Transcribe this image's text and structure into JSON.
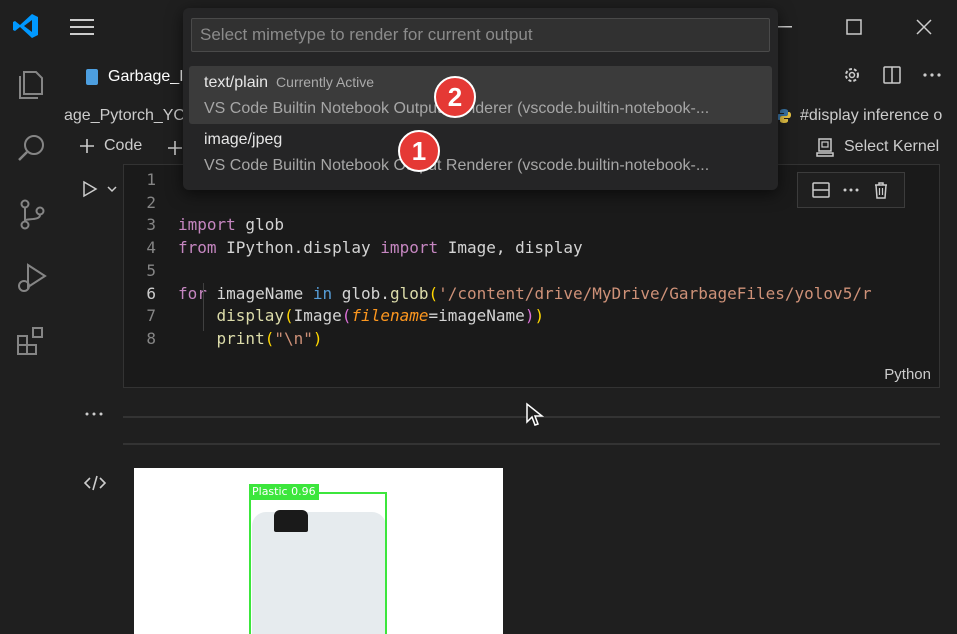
{
  "window": {
    "tab_title": "Garbage_I"
  },
  "breadcrumb": {
    "left": "age_Pytorch_YC",
    "right": "#display inference o"
  },
  "toolbar": {
    "add_code": "Code",
    "select_kernel": "Select Kernel"
  },
  "cell": {
    "language": "Python",
    "line_numbers": [
      "1",
      "2",
      "3",
      "4",
      "5",
      "6",
      "7",
      "8"
    ]
  },
  "quick_pick": {
    "placeholder": "Select mimetype to render for current output",
    "items": [
      {
        "label": "text/plain",
        "description": "Currently Active",
        "detail": "VS Code Builtin Notebook Output Renderer (vscode.builtin-notebook-..."
      },
      {
        "label": "image/jpeg",
        "description": "",
        "detail": "VS Code Builtin Notebook Output Renderer (vscode.builtin-notebook-..."
      }
    ]
  },
  "annotations": {
    "badge_1": "1",
    "badge_2": "2"
  },
  "output": {
    "detection_label": "Plastic 0.96"
  },
  "colors": {
    "accent_blue": "#0078d4",
    "badge_red": "#e53935",
    "detection_green": "#3ce63c"
  },
  "icons": [
    "vscode-logo",
    "menu-icon",
    "explorer-icon",
    "search-icon",
    "source-control-icon",
    "run-debug-icon",
    "extensions-icon",
    "gear-icon",
    "split-editor-icon",
    "more-icon",
    "python-icon",
    "kernel-icon",
    "run-icon",
    "chevron-down-icon",
    "split-cell-icon",
    "delete-icon",
    "code-output-icon",
    "mouse-cursor-icon"
  ]
}
